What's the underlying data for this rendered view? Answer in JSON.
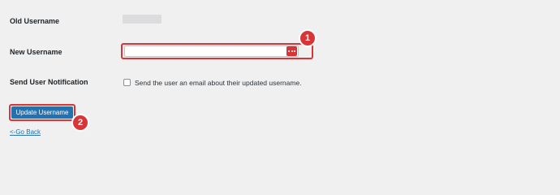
{
  "form": {
    "old_username_label": "Old Username",
    "new_username_label": "New Username",
    "new_username_value": "",
    "notify_label": "Send User Notification",
    "notify_checkbox_text": "Send the user an email about their updated username.",
    "notify_checked": false,
    "submit_label": "Update Username",
    "back_link": "<-Go Back"
  },
  "annotations": {
    "step_1": "1",
    "step_2": "2"
  },
  "colors": {
    "background": "#f0f0f1",
    "annotation_red": "#d63638",
    "primary_button": "#2271b1",
    "redacted_value": "#dcdcde"
  },
  "icons": {
    "password_manager": "password-manager-icon"
  }
}
